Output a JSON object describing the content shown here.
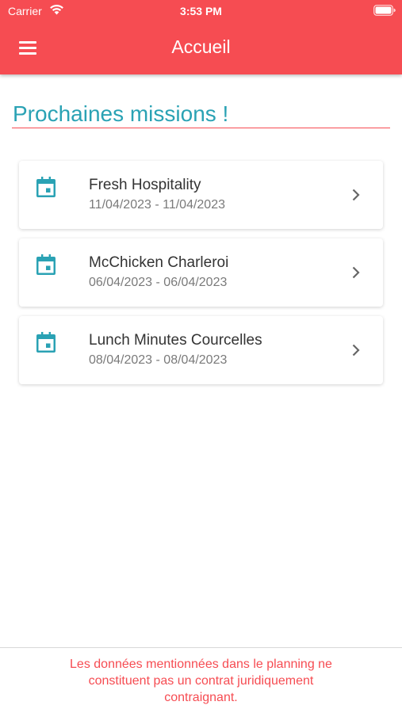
{
  "status_bar": {
    "carrier": "Carrier",
    "time": "3:53 PM",
    "icons": [
      "wifi-icon",
      "battery-icon"
    ]
  },
  "header": {
    "title": "Accueil",
    "menu_icon": "hamburger-menu-icon"
  },
  "section": {
    "title": "Prochaines missions !"
  },
  "missions": [
    {
      "name": "Fresh Hospitality",
      "dates": "11/04/2023 - 11/04/2023",
      "icon": "calendar-icon"
    },
    {
      "name": "McChicken Charleroi",
      "dates": "06/04/2023 - 06/04/2023",
      "icon": "calendar-icon"
    },
    {
      "name": "Lunch Minutes Courcelles",
      "dates": "08/04/2023 - 08/04/2023",
      "icon": "calendar-icon"
    }
  ],
  "footer": {
    "line1": "Les données mentionnées dans le planning ne",
    "line2": "constituent pas un contrat juridiquement",
    "line3": "contraignant."
  },
  "colors": {
    "brand_red": "#f64c52",
    "accent_teal": "#2aa2b4",
    "text_dark": "#333333",
    "text_muted": "#7a7a7a"
  }
}
